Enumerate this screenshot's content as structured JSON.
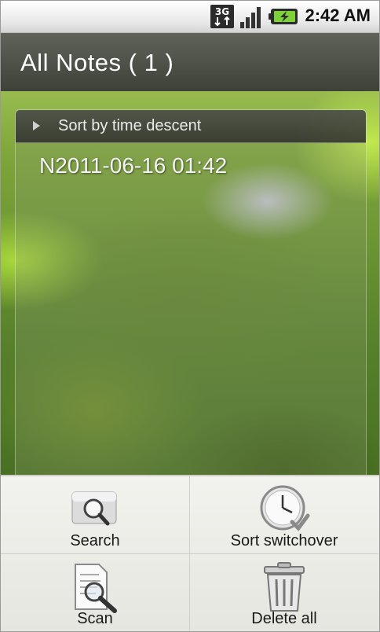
{
  "status_bar": {
    "network_label": "3G",
    "time": "2:42 AM",
    "icons": [
      "3g-data-icon",
      "signal-strength-icon",
      "battery-charging-icon"
    ]
  },
  "header": {
    "title": "All Notes ( 1 )"
  },
  "list": {
    "sort_label": "Sort by time descent",
    "items": [
      {
        "title": "N2011-06-16 01:42"
      }
    ]
  },
  "menu": {
    "items": [
      {
        "label": "Search",
        "icon": "search-icon"
      },
      {
        "label": "Sort switchover",
        "icon": "clock-icon"
      },
      {
        "label": "Scan",
        "icon": "scan-document-icon"
      },
      {
        "label": "Delete all",
        "icon": "trash-icon"
      }
    ]
  },
  "colors": {
    "menu_bg": "#ececE6",
    "title_bar": "#4a4a4a",
    "accent_green": "#8bc43a"
  }
}
